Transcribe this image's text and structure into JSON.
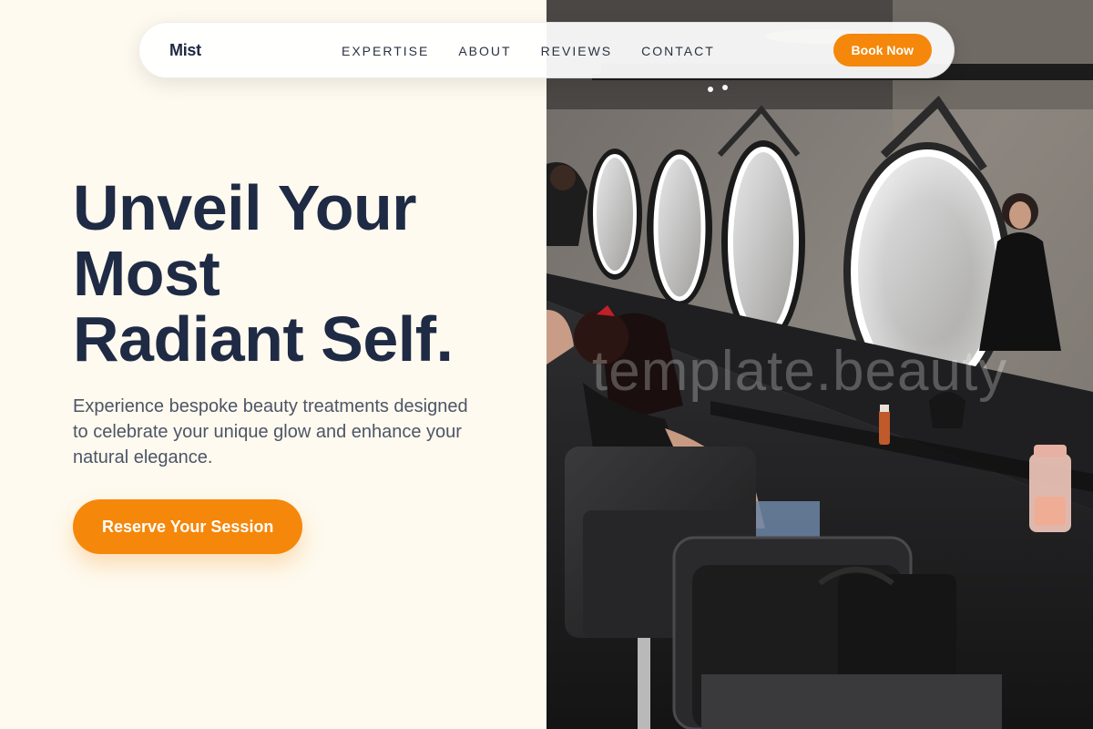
{
  "brand": {
    "name": "Mist"
  },
  "nav": {
    "links": [
      {
        "label": "EXPERTISE"
      },
      {
        "label": "ABOUT"
      },
      {
        "label": "REVIEWS"
      },
      {
        "label": "CONTACT"
      }
    ],
    "cta_label": "Book Now"
  },
  "hero": {
    "title_line1": "Unveil Your",
    "title_line2": "Most",
    "title_line3": "Radiant Self.",
    "subtitle": "Experience bespoke beauty treatments designed to celebrate your unique glow and enhance your natural elegance.",
    "cta_label": "Reserve Your Session"
  },
  "image": {
    "watermark": "template.beauty"
  },
  "colors": {
    "accent": "#f5870a",
    "heading": "#1f2a44",
    "body_text": "#4d5566",
    "background": "#fefaef"
  }
}
